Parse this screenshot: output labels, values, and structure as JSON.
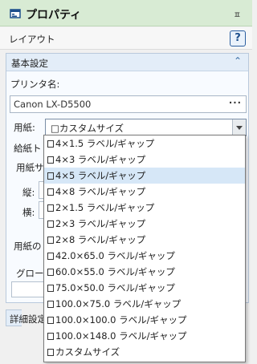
{
  "window": {
    "title": "プロパティ",
    "pin_glyph": "ㅍ",
    "icon": "properties-icon"
  },
  "toolbar": {
    "label": "レイアウト",
    "help_label": "?"
  },
  "basic_section": {
    "title": "基本設定",
    "collapse_glyph": "⌃",
    "printer_label": "プリンタ名:",
    "printer_value": "Canon LX-D5500",
    "browse_label": "···",
    "paper_label": "用紙:",
    "paper_value": "□カスタムサイズ",
    "hidden_labels": [
      "給紙ト",
      "用紙サ",
      "縦:",
      "横:",
      "用紙の",
      "グローバ"
    ]
  },
  "detail_section": {
    "title": "詳細設定"
  },
  "paper_options": [
    "4×1.5 ラベル/ギャップ",
    "4×3 ラベル/ギャップ",
    "4×5 ラベル/ギャップ",
    "4×8 ラベル/ギャップ",
    "2×1.5 ラベル/ギャップ",
    "2×3 ラベル/ギャップ",
    "2×8 ラベル/ギャップ",
    "42.0×65.0 ラベル/ギャップ",
    "60.0×55.0 ラベル/ギャップ",
    "75.0×50.0 ラベル/ギャップ",
    "100.0×75.0  ラベル/ギャップ",
    "100.0×100.0 ラベル/ギャップ",
    "100.0×148.0 ラベル/ギャップ",
    "カスタムサイズ"
  ],
  "highlighted_option": "4×5 ラベル/ギャップ",
  "colors": {
    "title_bg": "#d8ebd4",
    "section_bg": "#e3edf8",
    "highlight": "#d6e7f7",
    "accent": "#2b5fa0"
  }
}
